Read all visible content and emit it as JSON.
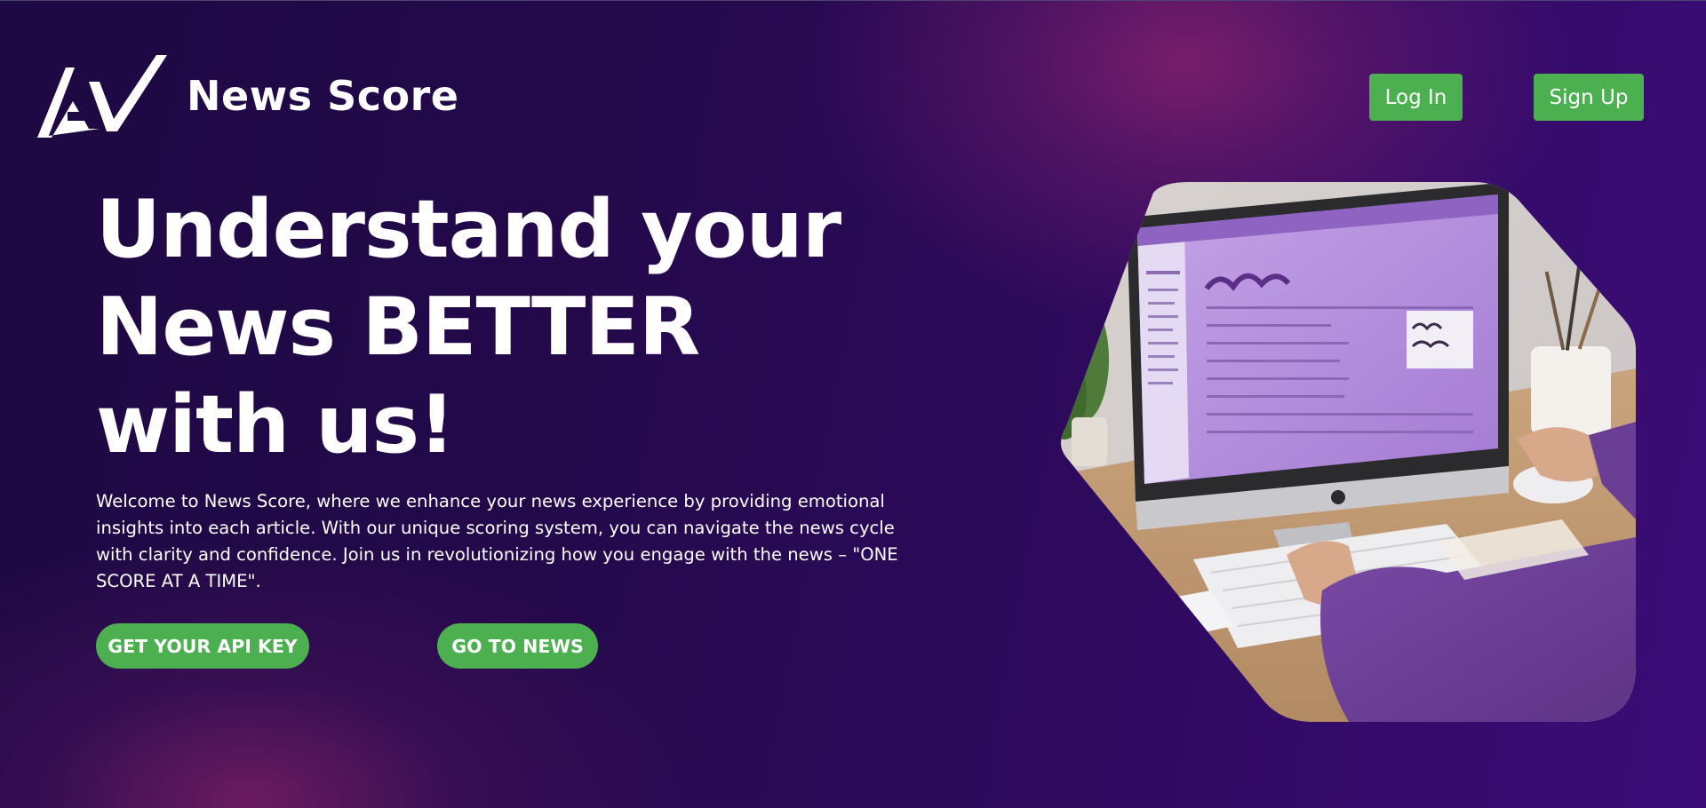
{
  "header": {
    "brand_name": "News Score",
    "logo_icon": "av-monogram-logo",
    "login_label": "Log In",
    "signup_label": "Sign Up"
  },
  "hero": {
    "headline_lines": [
      "Understand your",
      "News BETTER",
      "with us!"
    ],
    "description": "Welcome to News Score, where we enhance your news experience by providing emotional insights into each article. With our unique scoring system, you can navigate the news cycle with clarity and confidence. Join us in revolutionizing how you engage with the news – \"ONE SCORE AT A TIME\".",
    "api_key_button": "GET YOUR API KEY",
    "news_button": "GO TO NEWS",
    "image_icon": "person-typing-at-computer-illustration"
  },
  "colors": {
    "accent": "#4caf50",
    "background_dark": "#1d0943",
    "background_purple": "#3b0c78",
    "glow_magenta": "#8c236e",
    "text": "#ffffff"
  }
}
